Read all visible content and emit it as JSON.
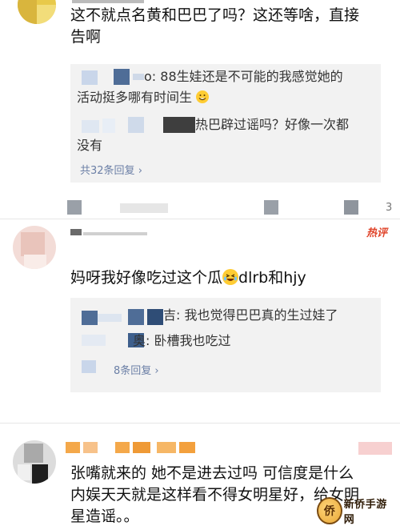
{
  "comments": [
    {
      "main_line1": "这不就点名黄和巴巴了吗？这还等啥，直接",
      "main_line2": "告啊",
      "replies": [
        {
          "text_a": "88生娃还是不可能的我感觉她的",
          "text_b": "活动挺多哪有时间生",
          "sep": "o:"
        },
        {
          "text_a": "热巴辟过谣吗？好像一次都",
          "text_b": "没有"
        }
      ],
      "more_label": "共32条回复",
      "footer_suffix": "3"
    },
    {
      "badge": "热评",
      "main_line1": "妈呀我好像吃过这个瓜",
      "main_suffix": "dlrb和hjy",
      "replies": [
        {
          "sep": "吉:",
          "text_a": "我也觉得巴巴真的生过娃了"
        },
        {
          "sep": "奥:",
          "text_a": "卧槽我也吃过"
        }
      ],
      "more_label": "8条回复"
    },
    {
      "main_line1": "张嘴就来的 她不是进去过吗 可信度是什么",
      "main_line2": "内娱天天就是这样看不得女明星好，给女明",
      "main_line3": "星造谣。。"
    }
  ],
  "watermark": {
    "text": "新侨手游网",
    "icon": "emblem-icon"
  },
  "icons": {
    "emoji_laugh": "laughing-emoji-icon",
    "emoji_grin": "grinning-emoji-icon",
    "arrow": "chevron-right-icon"
  },
  "colors": {
    "link": "#6b7fa6",
    "hot": "#e0442a",
    "reply_bg": "#f2f2f2"
  }
}
